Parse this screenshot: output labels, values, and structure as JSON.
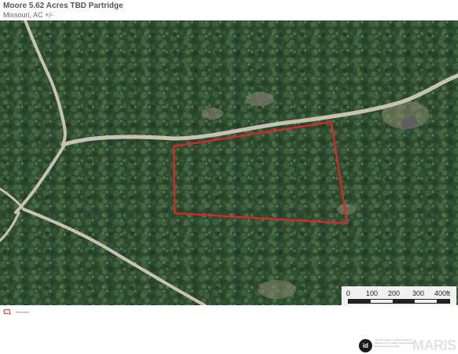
{
  "header": {
    "title": "Moore 5.62 Acres TBD Partridge",
    "subtitle": "Missouri,  AC +/-"
  },
  "map": {
    "imagery": "aerial-satellite",
    "colors": {
      "forest": "#2d4a2f",
      "road": "#c7c2b3",
      "boundary": "#e0242b"
    },
    "scale_bar": {
      "labels": [
        "0",
        "100",
        "200",
        "300",
        "400ft"
      ]
    }
  },
  "legend": {
    "label": "Boundary",
    "color": "#e0242b"
  },
  "footer": {
    "logo_text": "id",
    "disclaimer": "The information contained herein is believed to be reliable. Land boundaries shown are approximate.",
    "brand": "MARIS"
  }
}
